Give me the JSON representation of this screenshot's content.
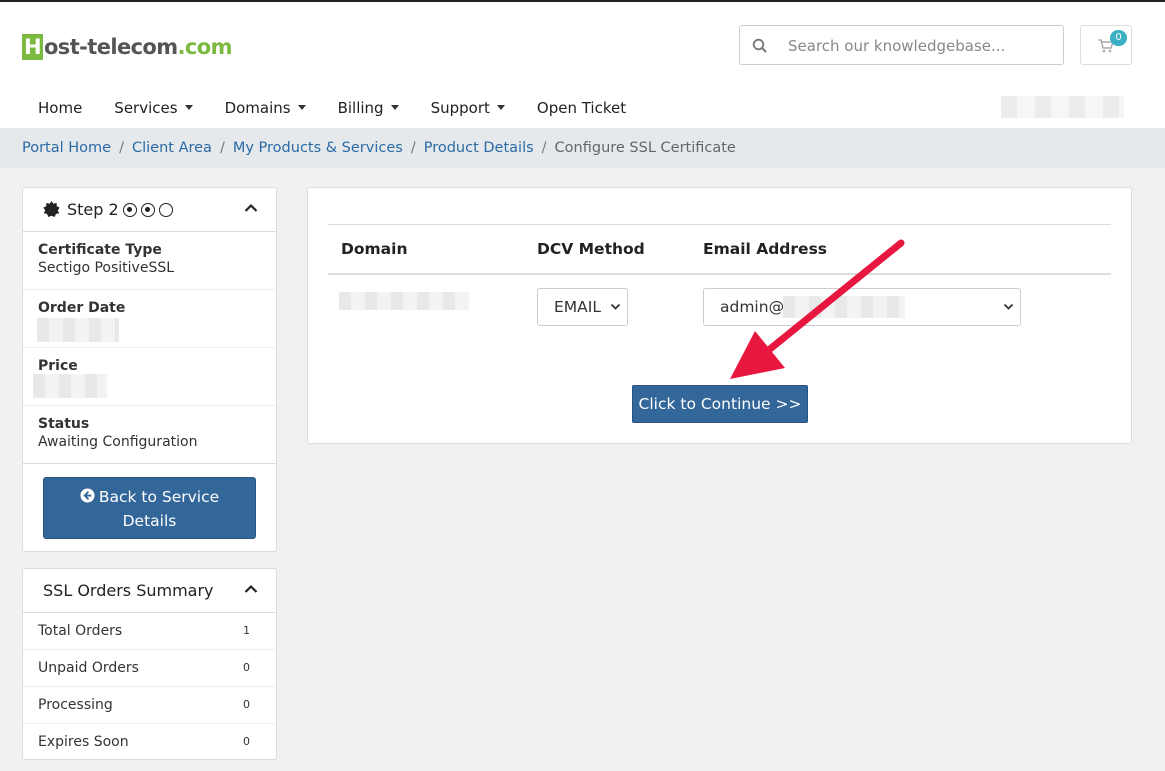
{
  "brand": {
    "name_first": "H",
    "name_rest": "ost-telecom",
    "name_dot": ".com"
  },
  "search": {
    "placeholder": "Search our knowledgebase..."
  },
  "cart": {
    "count": "0"
  },
  "nav": {
    "items": [
      {
        "label": "Home"
      },
      {
        "label": "Services"
      },
      {
        "label": "Domains"
      },
      {
        "label": "Billing"
      },
      {
        "label": "Support"
      },
      {
        "label": "Open Ticket"
      }
    ]
  },
  "breadcrumb": {
    "items": [
      "Portal Home",
      "Client Area",
      "My Products & Services",
      "Product Details"
    ],
    "active": "Configure SSL Certificate"
  },
  "step_panel": {
    "title": "Step 2",
    "rows": [
      {
        "label": "Certificate Type",
        "value": "Sectigo PositiveSSL"
      },
      {
        "label": "Order Date",
        "value": ""
      },
      {
        "label": "Price",
        "value": ""
      },
      {
        "label": "Status",
        "value": "Awaiting Configuration"
      }
    ],
    "back_button_line1": "Back to Service",
    "back_button_line2": "Details"
  },
  "summary_panel": {
    "title": "SSL Orders Summary",
    "rows": [
      {
        "label": "Total Orders",
        "count": "1"
      },
      {
        "label": "Unpaid Orders",
        "count": "0"
      },
      {
        "label": "Processing",
        "count": "0"
      },
      {
        "label": "Expires Soon",
        "count": "0"
      }
    ]
  },
  "dcv_table": {
    "headers": {
      "domain": "Domain",
      "method": "DCV Method",
      "email": "Email Address"
    },
    "row": {
      "method": "EMAIL",
      "email_prefix": "admin@"
    },
    "continue_label": "Click to Continue >>"
  },
  "colors": {
    "primary": "#336699",
    "accent": "#e8173f",
    "brand_green": "#7cb940",
    "badge": "#3ab0c3"
  }
}
